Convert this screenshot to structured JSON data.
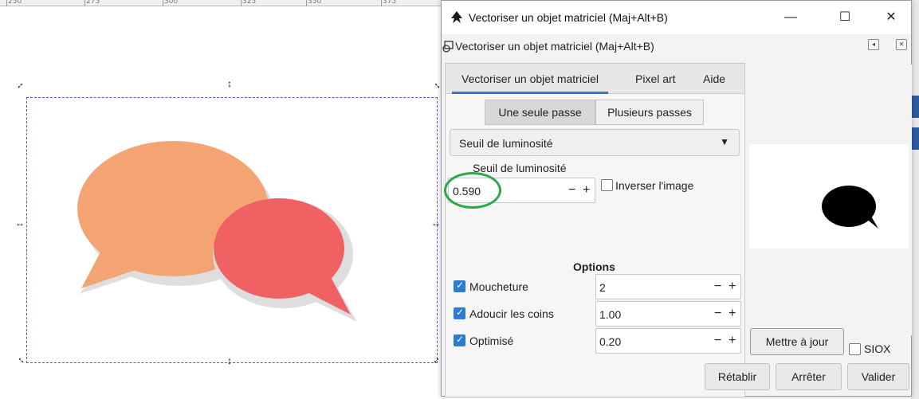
{
  "ruler": {
    "ticks": [
      "250",
      "275",
      "300",
      "325",
      "350",
      "375"
    ]
  },
  "dialog": {
    "window_title": "Vectoriser un objet matriciel (Maj+Alt+B)",
    "window_controls": {
      "minimize": "—",
      "maximize": "☐",
      "close": "✕"
    },
    "subheader_label": "Vectoriser un objet matriciel (Maj+Alt+B)",
    "tabs": [
      {
        "label": "Vectoriser un objet matriciel",
        "active": true
      },
      {
        "label": "Pixel art",
        "active": false
      },
      {
        "label": "Aide",
        "active": false
      }
    ],
    "mode": {
      "single": "Une seule passe",
      "multi": "Plusieurs passes",
      "selected": "single"
    },
    "method_select": {
      "value": "Seuil de luminosité"
    },
    "threshold": {
      "label": "Seuil de luminosité",
      "value": "0.590",
      "minus": "−",
      "plus": "+"
    },
    "invert": {
      "label": "Inverser l'image",
      "checked": false
    },
    "options": {
      "title": "Options",
      "rows": [
        {
          "label": "Moucheture",
          "checked": true,
          "value": "2"
        },
        {
          "label": "Adoucir les coins",
          "checked": true,
          "value": "1.00"
        },
        {
          "label": "Optimisé",
          "checked": true,
          "value": "0.20"
        }
      ],
      "minus": "−",
      "plus": "+"
    },
    "preview": {
      "update_button": "Mettre à jour",
      "siox_label": "SIOX",
      "siox_checked": false
    },
    "footer": {
      "reset": "Rétablir",
      "stop": "Arrêter",
      "ok": "Valider"
    }
  },
  "colors": {
    "bubble_orange": "#f4a473",
    "bubble_red": "#f06163",
    "shadow": "#dedede",
    "accent": "#2e7bd6",
    "annotation_circle": "#2aa84a"
  },
  "icons": {
    "handles": "double-arrow-icon",
    "app": "inkscape-icon",
    "subheader": "trace-bitmap-icon"
  }
}
